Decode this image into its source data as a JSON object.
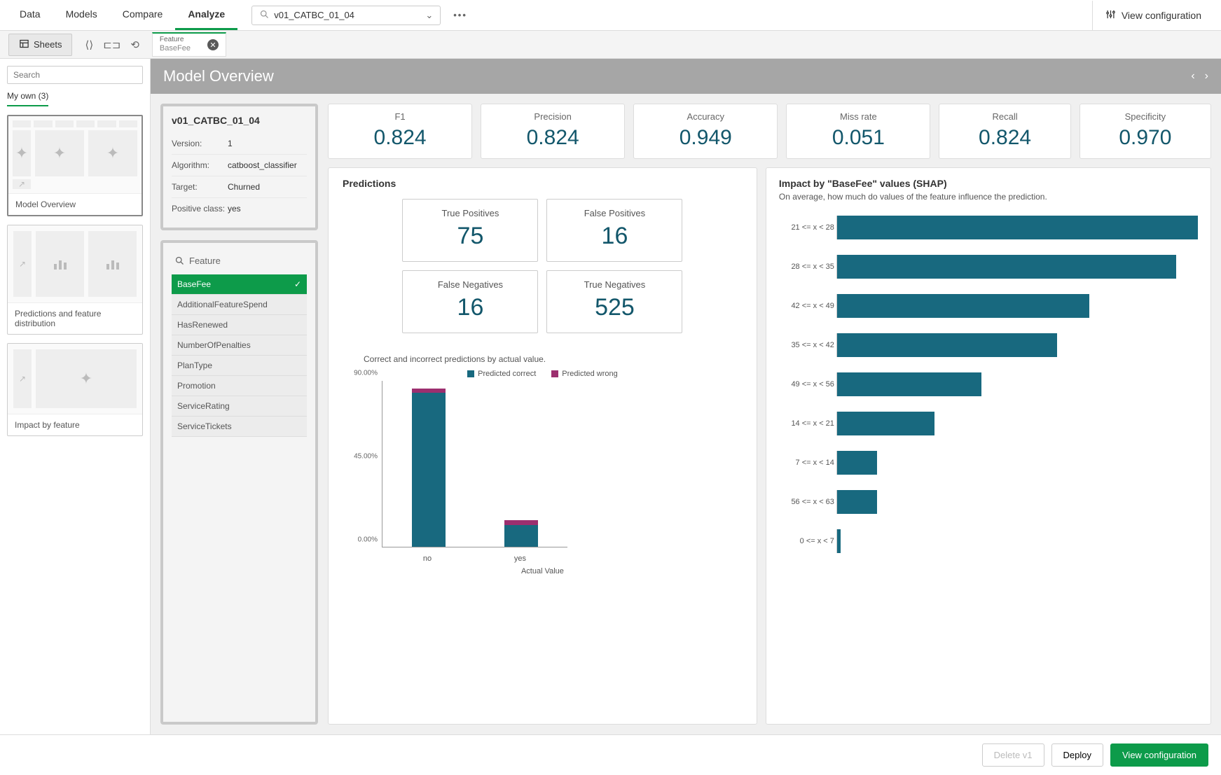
{
  "topnav": {
    "tabs": [
      "Data",
      "Models",
      "Compare",
      "Analyze"
    ],
    "active_tab": "Analyze",
    "selected_model": "v01_CATBC_01_04",
    "view_config": "View configuration"
  },
  "toolbar": {
    "sheets": "Sheets",
    "chip_label": "Feature",
    "chip_value": "BaseFee"
  },
  "sidebar": {
    "search_placeholder": "Search",
    "tab": "My own (3)",
    "sheets": [
      {
        "label": "Model Overview"
      },
      {
        "label": "Predictions and feature distribution"
      },
      {
        "label": "Impact by feature"
      }
    ]
  },
  "page_title": "Model Overview",
  "model_panel": {
    "title": "v01_CATBC_01_04",
    "rows": [
      {
        "k": "Version:",
        "v": "1"
      },
      {
        "k": "Algorithm:",
        "v": "catboost_classifier"
      },
      {
        "k": "Target:",
        "v": "Churned"
      },
      {
        "k": "Positive class:",
        "v": "yes"
      }
    ]
  },
  "feature_panel": {
    "search_label": "Feature",
    "items": [
      "BaseFee",
      "AdditionalFeatureSpend",
      "HasRenewed",
      "NumberOfPenalties",
      "PlanType",
      "Promotion",
      "ServiceRating",
      "ServiceTickets"
    ],
    "selected": "BaseFee"
  },
  "metrics": [
    {
      "label": "F1",
      "value": "0.824"
    },
    {
      "label": "Precision",
      "value": "0.824"
    },
    {
      "label": "Accuracy",
      "value": "0.949"
    },
    {
      "label": "Miss rate",
      "value": "0.051"
    },
    {
      "label": "Recall",
      "value": "0.824"
    },
    {
      "label": "Specificity",
      "value": "0.970"
    }
  ],
  "predictions": {
    "title": "Predictions",
    "confusion": [
      {
        "label": "True Positives",
        "value": "75"
      },
      {
        "label": "False Positives",
        "value": "16"
      },
      {
        "label": "False Negatives",
        "value": "16"
      },
      {
        "label": "True Negatives",
        "value": "525"
      }
    ],
    "chart_desc": "Correct and incorrect predictions by actual value.",
    "legend": {
      "correct": "Predicted correct",
      "wrong": "Predicted wrong"
    },
    "x_title": "Actual Value"
  },
  "shap": {
    "title": "Impact by \"BaseFee\" values (SHAP)",
    "subtitle": "On average, how much do values of the feature influence the prediction."
  },
  "footer": {
    "delete": "Delete v1",
    "deploy": "Deploy",
    "view_config": "View configuration"
  },
  "colors": {
    "teal": "#18697f",
    "magenta": "#9c2f6f",
    "green": "#0d9b4a"
  },
  "chart_data": [
    {
      "type": "bar",
      "name": "predictions_by_actual",
      "stacked": true,
      "categories": [
        "no",
        "yes"
      ],
      "series": [
        {
          "name": "Predicted correct",
          "values": [
            83.1,
            11.9
          ],
          "color": "#18697f"
        },
        {
          "name": "Predicted wrong",
          "values": [
            2.5,
            2.5
          ],
          "color": "#9c2f6f"
        }
      ],
      "xlabel": "Actual Value",
      "ylabel": "",
      "y_ticks": [
        "0.00%",
        "45.00%",
        "90.00%"
      ],
      "ylim": [
        0,
        90
      ]
    },
    {
      "type": "bar",
      "name": "shap_impact_basefee",
      "orientation": "horizontal",
      "categories": [
        "21 <= x < 28",
        "28 <= x < 35",
        "42 <= x < 49",
        "35 <= x < 42",
        "49 <= x < 56",
        "14 <= x < 21",
        "7 <= x < 14",
        "56 <= x < 63",
        "0 <= x < 7"
      ],
      "values": [
        100,
        94,
        70,
        61,
        40,
        27,
        11,
        11,
        1
      ],
      "title": "Impact by \"BaseFee\" values (SHAP)",
      "xlabel": "",
      "ylabel": ""
    }
  ]
}
